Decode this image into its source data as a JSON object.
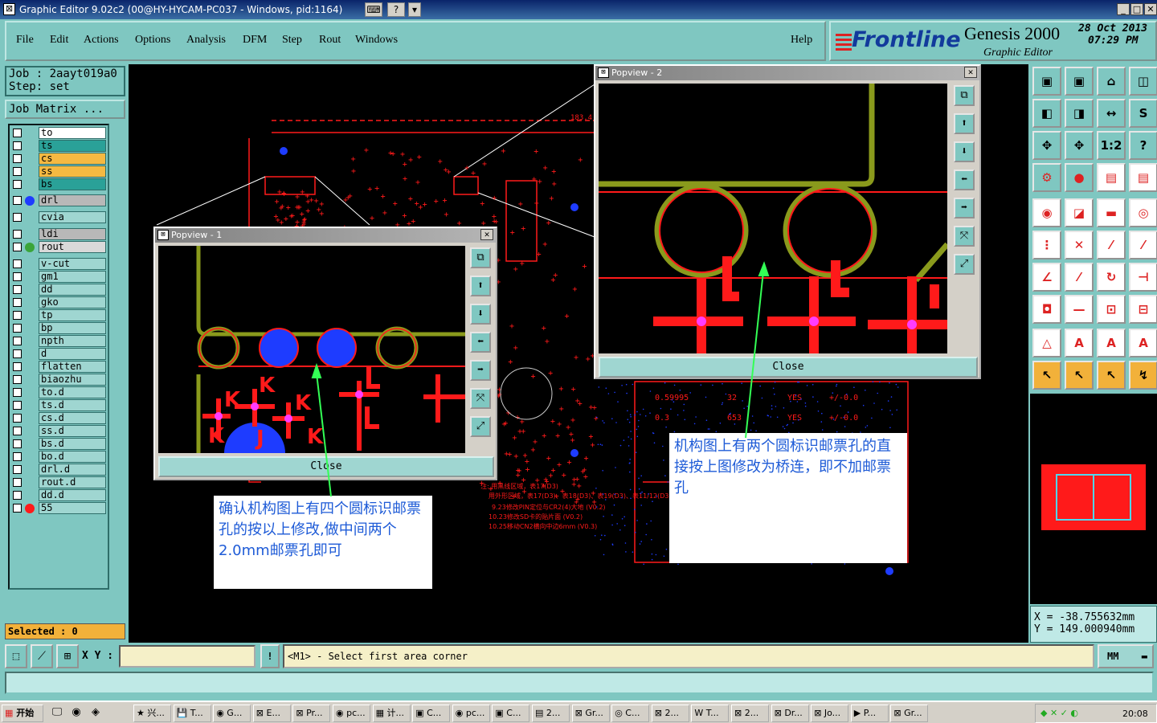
{
  "window": {
    "title": "Graphic Editor 9.02c2 (00@HY-HYCAM-PC037 - Windows, pid:1164)"
  },
  "menu": {
    "file": "File",
    "edit": "Edit",
    "actions": "Actions",
    "options": "Options",
    "analysis": "Analysis",
    "dfm": "DFM",
    "step": "Step",
    "rout": "Rout",
    "windows": "Windows",
    "help": "Help"
  },
  "brand": {
    "logo": "Frontline",
    "product": "Genesis 2000",
    "subtitle": "Graphic Editor",
    "date": "28 Oct 2013",
    "time": "07:29 PM"
  },
  "job": {
    "job_line": "Job : 2aayt019a0",
    "step_line": "Step: set",
    "matrix_button": "Job Matrix ..."
  },
  "layers": [
    {
      "name": "to",
      "color": "#ffffff",
      "dot": ""
    },
    {
      "name": "ts",
      "color": "#2aa198",
      "dot": ""
    },
    {
      "name": "cs",
      "color": "#f5b942",
      "dot": ""
    },
    {
      "name": "ss",
      "color": "#f5b942",
      "dot": ""
    },
    {
      "name": "bs",
      "color": "#2aa198",
      "dot": ""
    },
    {
      "name": "drl",
      "color": "#b8b8b8",
      "dot": "#1e3cff"
    },
    {
      "name": "cvia",
      "color": "#9fd6d1",
      "dot": ""
    },
    {
      "name": "ldi",
      "color": "#b8b8b8",
      "dot": ""
    },
    {
      "name": "rout",
      "color": "#d9d9d9",
      "dot": "#3aa53a"
    },
    {
      "name": "v-cut",
      "color": "#9fd6d1",
      "dot": ""
    },
    {
      "name": "gm1",
      "color": "#9fd6d1",
      "dot": ""
    },
    {
      "name": "dd",
      "color": "#9fd6d1",
      "dot": ""
    },
    {
      "name": "gko",
      "color": "#9fd6d1",
      "dot": ""
    },
    {
      "name": "tp",
      "color": "#9fd6d1",
      "dot": ""
    },
    {
      "name": "bp",
      "color": "#9fd6d1",
      "dot": ""
    },
    {
      "name": "npth",
      "color": "#9fd6d1",
      "dot": ""
    },
    {
      "name": "d",
      "color": "#9fd6d1",
      "dot": ""
    },
    {
      "name": "flatten",
      "color": "#9fd6d1",
      "dot": ""
    },
    {
      "name": "biaozhu",
      "color": "#9fd6d1",
      "dot": ""
    },
    {
      "name": "to.d",
      "color": "#9fd6d1",
      "dot": ""
    },
    {
      "name": "ts.d",
      "color": "#9fd6d1",
      "dot": ""
    },
    {
      "name": "cs.d",
      "color": "#9fd6d1",
      "dot": ""
    },
    {
      "name": "ss.d",
      "color": "#9fd6d1",
      "dot": ""
    },
    {
      "name": "bs.d",
      "color": "#9fd6d1",
      "dot": ""
    },
    {
      "name": "bo.d",
      "color": "#9fd6d1",
      "dot": ""
    },
    {
      "name": "drl.d",
      "color": "#9fd6d1",
      "dot": ""
    },
    {
      "name": "rout.d",
      "color": "#9fd6d1",
      "dot": ""
    },
    {
      "name": "dd.d",
      "color": "#9fd6d1",
      "dot": ""
    },
    {
      "name": "55",
      "color": "#9fd6d1",
      "dot": "#ff1a1a"
    }
  ],
  "selected": "Selected : 0",
  "popview1": {
    "title": "Popview - 1",
    "close": "Close"
  },
  "popview2": {
    "title": "Popview - 2",
    "close": "Close"
  },
  "notes": {
    "left": "确认机构图上有四个圆标识邮票孔的按以上修改,做中间两个2.0mm邮票孔即可",
    "right": "机构图上有两个圆标识邮票孔的直接按上图修改为桥连，即不加邮票孔"
  },
  "canvas": {
    "dimension": "183.4",
    "table": [
      [
        "0.59995",
        "32",
        "YES",
        "+/-0.0"
      ],
      [
        "0.3",
        "653",
        "YES",
        "+/-0.0"
      ]
    ],
    "red_notes": [
      "注: 用黑线区域，表17(D3)",
      "用外形区域，表17(D3)、表18(D3)、表19(D3)、表11/12(D3)",
      "9.23修改PIN定位与CR2(4)大地 (V0.2)",
      "10.23修改SD卡的贴片面 (V0.2)",
      "10.25移动CN2横向中边6mm (V0.3)"
    ]
  },
  "coords": {
    "x_line": "X = -38.755632mm",
    "y_line": "Y = 149.000940mm"
  },
  "status": {
    "xy_label": "X Y :",
    "xy_value": "",
    "prompt": "<M1> - Select first area corner",
    "units": "MM",
    "message": ""
  },
  "taskbar": {
    "start": "开始",
    "clock": "20:08",
    "tasks": [
      "兴...",
      "T...",
      "G...",
      "E...",
      "Pr...",
      "pc...",
      "计...",
      "C...",
      "pc...",
      "C...",
      "2...",
      "Gr...",
      "C...",
      "2...",
      "T...",
      "2...",
      "Dr...",
      "Jo...",
      "P...",
      "Gr..."
    ]
  },
  "colors": {
    "board_red": "#ff1a1a",
    "outline_olive": "#8a9a1c",
    "pad_blue": "#1e3cff",
    "highlight_magenta": "#ff3cff",
    "arrow_green": "#33ff55"
  }
}
